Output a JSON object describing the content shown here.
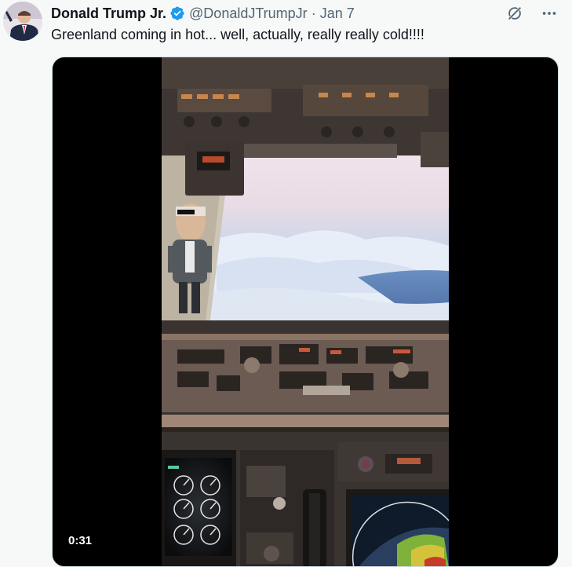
{
  "tweet": {
    "author_name": "Donald Trump Jr.",
    "handle": "@DonaldJTrumpJr",
    "separator": "·",
    "date": "Jan 7",
    "text": "Greenland coming in hot... well, actually, really really cold!!!!"
  },
  "video": {
    "duration": "0:31"
  },
  "icons": {
    "verified": "verified-badge-icon",
    "grok": "grok-icon",
    "more": "more-icon"
  },
  "colors": {
    "verified_blue": "#1d9bf0",
    "text_primary": "#0f1419",
    "text_secondary": "#536471",
    "background": "#f7f9f9"
  }
}
